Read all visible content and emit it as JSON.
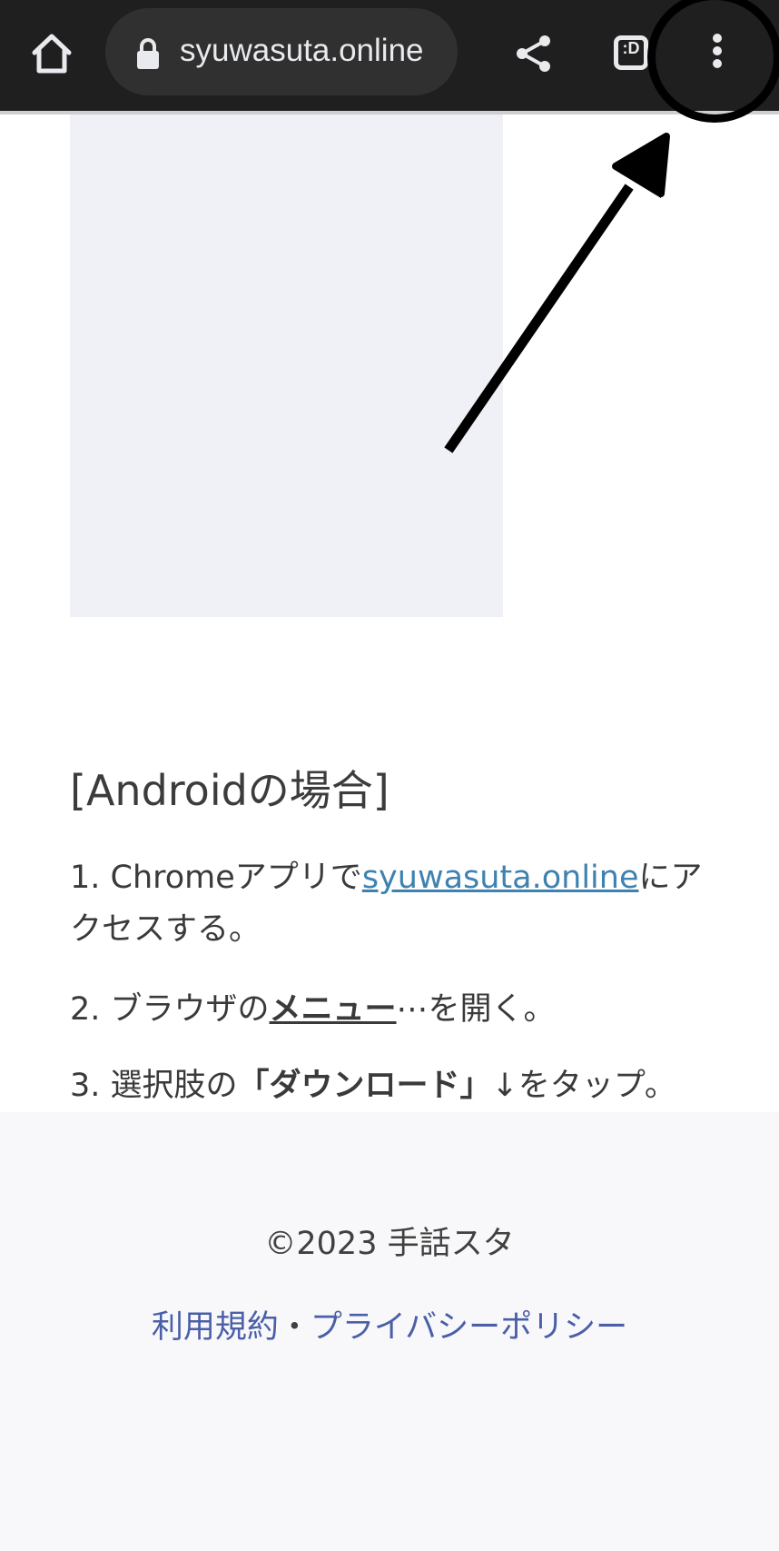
{
  "browser": {
    "url": "syuwasuta.online",
    "tab_count": ":D"
  },
  "article": {
    "heading": "[Androidの場合]",
    "step1_prefix": "1. Chromeアプリで",
    "step1_link": "syuwasuta.online",
    "step1_suffix": "にアクセスする。",
    "step2_prefix": "2. ブラウザの",
    "step2_bold": "メニュー",
    "step2_dots": "⋯",
    "step2_suffix": "を開く。",
    "step3_prefix": "3. 選択肢の",
    "step3_bold": "「ダウンロード」",
    "step3_arrow": "↓",
    "step3_suffix": "をタップ。"
  },
  "footer": {
    "copyright": "©2023 手話スタ",
    "terms_link": "利用規約",
    "separator": "・",
    "privacy_link": "プライバシーポリシー"
  },
  "icons": {
    "home": "home-icon",
    "lock": "lock-icon",
    "share": "share-icon",
    "tabs": "tab-switcher-icon",
    "menu": "more-vert-icon"
  },
  "colors": {
    "toolbar": "#1f1f1f",
    "url_pill": "#303030",
    "link": "#3f82b0",
    "footer_link": "#4a5fa8",
    "placeholder": "#f0f0f7",
    "footer_bg": "#f8f8fa"
  }
}
